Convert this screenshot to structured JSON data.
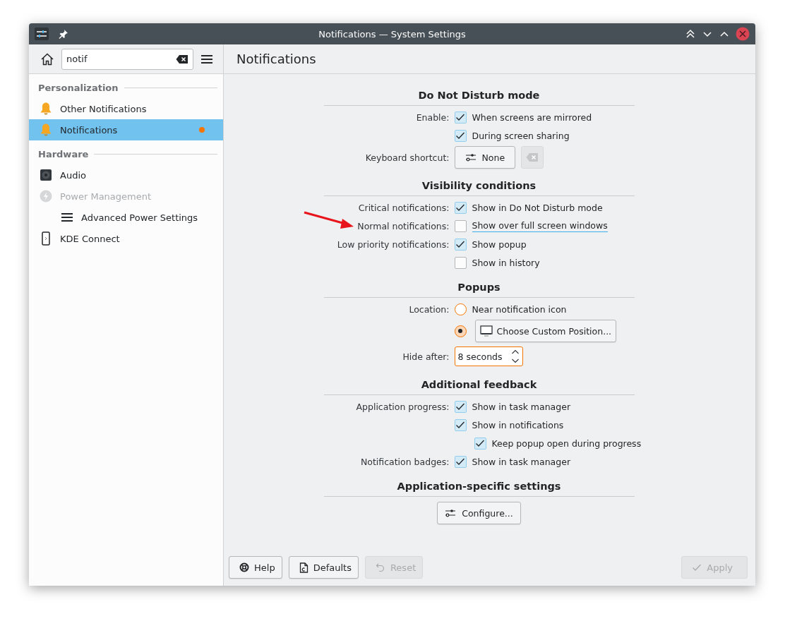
{
  "window": {
    "title": "Notifications — System Settings"
  },
  "sidebar": {
    "search": {
      "value": "notif"
    },
    "categories": [
      {
        "title": "Personalization",
        "items": [
          {
            "label": "Other Notifications",
            "selected": false,
            "disabled": false,
            "modified": false
          },
          {
            "label": "Notifications",
            "selected": true,
            "disabled": false,
            "modified": true
          }
        ]
      },
      {
        "title": "Hardware",
        "items": [
          {
            "label": "Audio",
            "selected": false,
            "disabled": false,
            "modified": false
          },
          {
            "label": "Power Management",
            "selected": false,
            "disabled": true,
            "modified": false,
            "children": [
              {
                "label": "Advanced Power Settings",
                "selected": false,
                "disabled": false,
                "modified": false
              }
            ]
          },
          {
            "label": "KDE Connect",
            "selected": false,
            "disabled": false,
            "modified": false
          }
        ]
      }
    ]
  },
  "page": {
    "title": "Notifications",
    "sections": [
      {
        "title": "Do Not Disturb mode",
        "rows": [
          {
            "kind": "check",
            "label": "Enable:",
            "text": "When screens are mirrored",
            "checked": true,
            "highlighted": false
          },
          {
            "kind": "check",
            "text": "During screen sharing",
            "checked": true,
            "highlighted": false
          },
          {
            "kind": "shortcut",
            "label": "Keyboard shortcut:",
            "button": "None",
            "clear_disabled": true
          }
        ]
      },
      {
        "title": "Visibility conditions",
        "rows": [
          {
            "kind": "check",
            "label": "Critical notifications:",
            "text": "Show in Do Not Disturb mode",
            "checked": true,
            "highlighted": false
          },
          {
            "kind": "check",
            "label": "Normal notifications:",
            "text": "Show over full screen windows",
            "checked": false,
            "highlighted": true
          },
          {
            "kind": "check",
            "label": "Low priority notifications:",
            "text": "Show popup",
            "checked": true,
            "highlighted": false
          },
          {
            "kind": "check",
            "text": "Show in history",
            "checked": false,
            "highlighted": false
          }
        ]
      },
      {
        "title": "Popups",
        "rows": [
          {
            "kind": "radio",
            "label": "Location:",
            "text": "Near notification icon",
            "selected": false
          },
          {
            "kind": "radio-button",
            "button": "Choose Custom Position...",
            "selected": true
          },
          {
            "kind": "spin",
            "label": "Hide after:",
            "value": "8 seconds",
            "focused": true
          }
        ]
      },
      {
        "title": "Additional feedback",
        "rows": [
          {
            "kind": "check",
            "label": "Application progress:",
            "text": "Show in task manager",
            "checked": true,
            "highlighted": false
          },
          {
            "kind": "check",
            "text": "Show in notifications",
            "checked": true,
            "highlighted": false,
            "children": [
              {
                "kind": "check",
                "text": "Keep popup open during progress",
                "checked": true,
                "highlighted": false
              }
            ]
          },
          {
            "kind": "check",
            "label": "Notification badges:",
            "text": "Show in task manager",
            "checked": true,
            "highlighted": false
          }
        ]
      },
      {
        "title": "Application-specific settings",
        "rows": [
          {
            "kind": "button",
            "button": "Configure..."
          }
        ]
      }
    ]
  },
  "footer": {
    "buttons": [
      {
        "label": "Help",
        "disabled": false
      },
      {
        "label": "Defaults",
        "disabled": false
      },
      {
        "label": "Reset",
        "disabled": true
      }
    ],
    "apply": {
      "label": "Apply",
      "disabled": true
    }
  }
}
